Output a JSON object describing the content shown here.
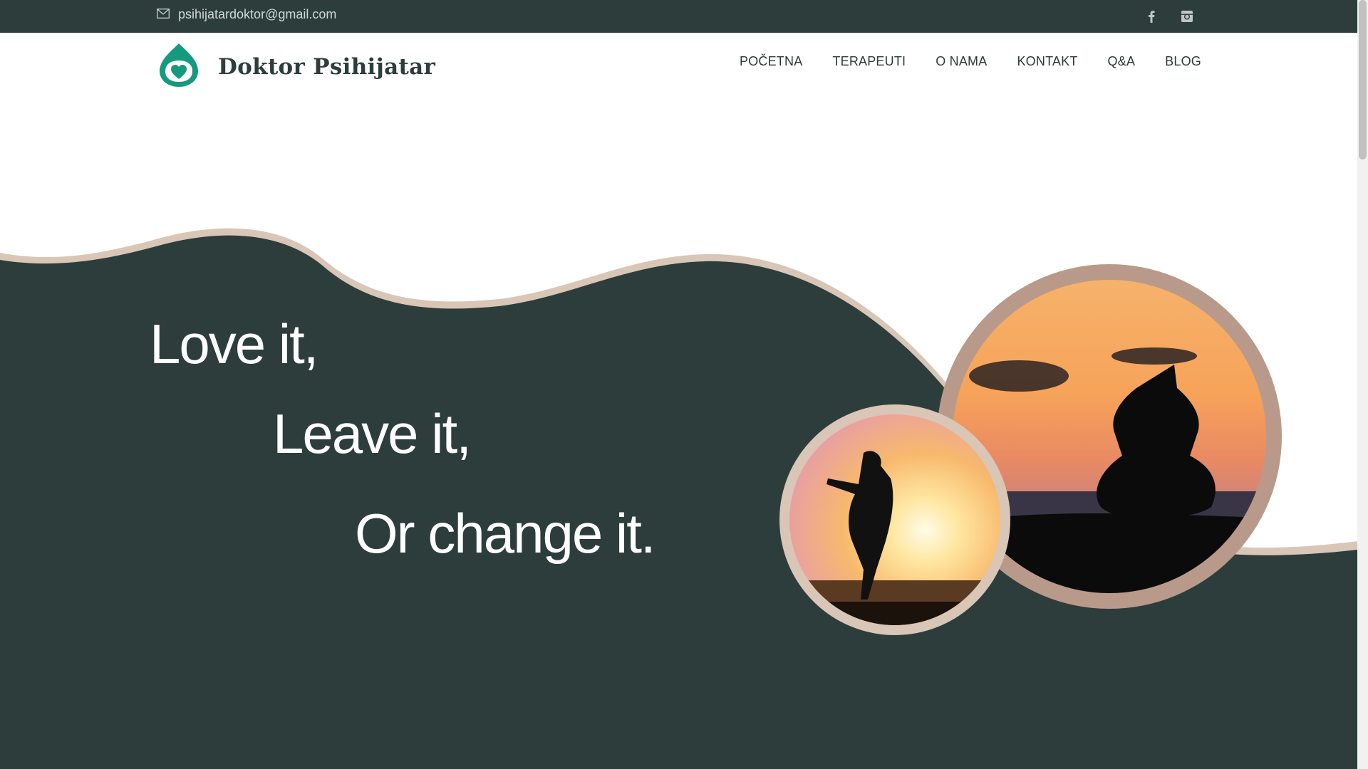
{
  "topbar": {
    "email": "psihijatardoktor@gmail.com",
    "social": [
      {
        "icon": "facebook-icon"
      },
      {
        "icon": "instagram-icon"
      }
    ]
  },
  "brand": {
    "name": "Doktor Psihijatar",
    "logo_icon": "heart-drop-logo-icon",
    "logo_color": "#169a7f"
  },
  "nav": {
    "items": [
      {
        "label": "POČETNA"
      },
      {
        "label": "TERAPEUTI"
      },
      {
        "label": "O NAMA"
      },
      {
        "label": "KONTAKT"
      },
      {
        "label": "Q&A"
      },
      {
        "label": "BLOG"
      }
    ]
  },
  "hero": {
    "lines": [
      "Love it,",
      "Leave it,",
      "Or change it."
    ],
    "background_color": "#2d3d3b",
    "wave_edge_color": "#d9c6b6",
    "ring_color": "#b99a8a",
    "images": [
      {
        "subject": "woman-silhouette-sunset"
      },
      {
        "subject": "yoga-meditation-silhouette-sunset"
      }
    ]
  },
  "colors": {
    "dark": "#2d3d3b",
    "accent": "#169a7f",
    "beige": "#d9c6b6"
  }
}
